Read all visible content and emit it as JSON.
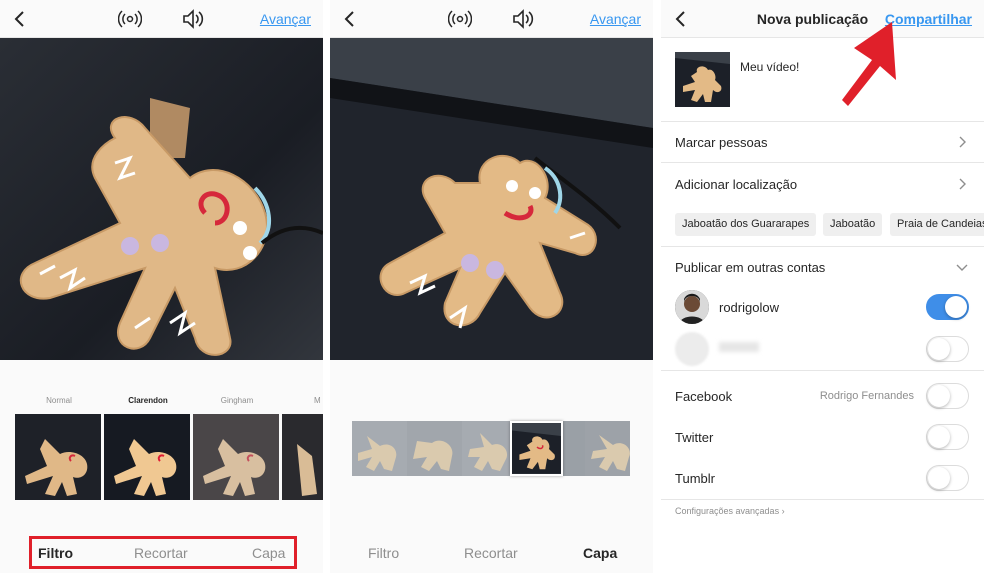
{
  "screen1": {
    "advance_label": "Avançar",
    "filters": [
      "Normal",
      "Clarendon",
      "Gingham",
      "M"
    ],
    "active_filter": "Clarendon",
    "tabs": [
      "Filtro",
      "Recortar",
      "Capa"
    ],
    "active_tab": "Filtro"
  },
  "screen2": {
    "advance_label": "Avançar",
    "tabs": [
      "Filtro",
      "Recortar",
      "Capa"
    ],
    "active_tab": "Capa"
  },
  "screen3": {
    "title": "Nova publicação",
    "share_label": "Compartilhar",
    "caption": "Meu vídeo!",
    "tag_people": "Marcar pessoas",
    "add_location": "Adicionar localização",
    "location_chips": [
      "Jaboatão dos Guararapes",
      "Jaboatão",
      "Praia de Candeias"
    ],
    "publish_other": "Publicar em outras contas",
    "accounts": [
      {
        "name": "rodrigolow",
        "on": true
      },
      {
        "name": "",
        "on": false
      }
    ],
    "networks": [
      {
        "name": "Facebook",
        "sub": "Rodrigo Fernandes",
        "on": false
      },
      {
        "name": "Twitter",
        "sub": "",
        "on": false
      },
      {
        "name": "Tumblr",
        "sub": "",
        "on": false
      }
    ],
    "advanced": "Configurações avançadas"
  },
  "colors": {
    "accent": "#3897f0",
    "highlight_red": "#e0202a",
    "toggle_on": "#3f8ee8"
  }
}
